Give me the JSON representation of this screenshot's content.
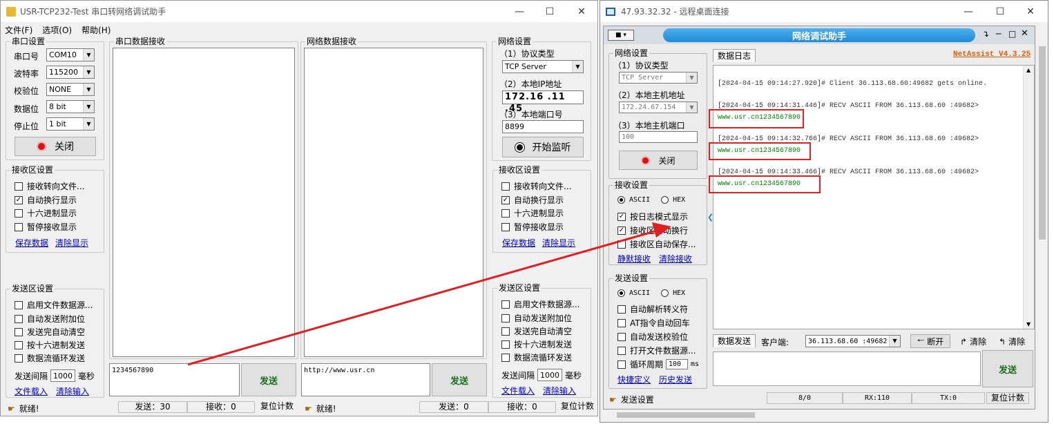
{
  "left": {
    "title": "USR-TCP232-Test 串口转网络调试助手",
    "menu": [
      "文件(F)",
      "选项(O)",
      "帮助(H)"
    ],
    "serial_settings": {
      "title": "串口设置",
      "port_label": "串口号",
      "port": "COM10",
      "baud_label": "波特率",
      "baud": "115200",
      "parity_label": "校验位",
      "parity": "NONE",
      "databits_label": "数据位",
      "databits": "8 bit",
      "stopbits_label": "停止位",
      "stopbits": "1 bit",
      "close_btn": "关闭"
    },
    "serial_receive_title": "串口数据接收",
    "net_receive_title": "网络数据接收",
    "recv_settings_left": {
      "title": "接收区设置",
      "options": [
        {
          "label": "接收转向文件...",
          "checked": false
        },
        {
          "label": "自动换行显示",
          "checked": true
        },
        {
          "label": "十六进制显示",
          "checked": false
        },
        {
          "label": "暂停接收显示",
          "checked": false
        }
      ],
      "save": "保存数据",
      "clear": "清除显示"
    },
    "send_settings_left": {
      "title": "发送区设置",
      "options": [
        {
          "label": "启用文件数据源...",
          "checked": false
        },
        {
          "label": "自动发送附加位",
          "checked": false
        },
        {
          "label": "发送完自动清空",
          "checked": false
        },
        {
          "label": "按十六进制发送",
          "checked": false
        },
        {
          "label": "数据流循环发送",
          "checked": false
        }
      ],
      "interval_label": "发送间隔",
      "interval": "1000",
      "unit": "毫秒",
      "load": "文件载入",
      "clear": "清除输入"
    },
    "serial_send_text": "1234567890",
    "net_send_text": "http://www.usr.cn",
    "send_btn": "发送",
    "net_settings": {
      "title": "网络设置",
      "proto_label": "（1）协议类型",
      "proto": "TCP Server",
      "ip_label": "（2）本地IP地址",
      "ip": "172.16 .11 .45",
      "port_label": "（3）本地端口号",
      "port": "8899",
      "listen_btn": "开始监听"
    },
    "recv_settings_right": {
      "title": "接收区设置",
      "options": [
        {
          "label": "接收转向文件...",
          "checked": false
        },
        {
          "label": "自动换行显示",
          "checked": true
        },
        {
          "label": "十六进制显示",
          "checked": false
        },
        {
          "label": "暂停接收显示",
          "checked": false
        }
      ],
      "save": "保存数据",
      "clear": "清除显示"
    },
    "send_settings_right": {
      "title": "发送区设置",
      "options": [
        {
          "label": "启用文件数据源...",
          "checked": false
        },
        {
          "label": "自动发送附加位",
          "checked": false
        },
        {
          "label": "发送完自动清空",
          "checked": false
        },
        {
          "label": "按十六进制发送",
          "checked": false
        },
        {
          "label": "数据流循环发送",
          "checked": false
        }
      ],
      "interval_label": "发送间隔",
      "interval": "1000",
      "unit": "毫秒",
      "load": "文件载入",
      "clear": "清除输入"
    },
    "status": {
      "ready1": "就绪!",
      "send1": "发送：30",
      "recv1": "接收：0",
      "reset1": "复位计数",
      "ready2": "就绪!",
      "send2": "发送：0",
      "recv2": "接收：0",
      "reset2": "复位计数"
    }
  },
  "right": {
    "title": "47.93.32.32 - 远程桌面连接",
    "app_title": "网络调试助手",
    "version": "NetAssist V4.3.25",
    "net_settings": {
      "title": "网络设置",
      "proto_label": "（1）协议类型",
      "proto": "TCP Server",
      "host_label": "（2）本地主机地址",
      "host": "172.24.67.154",
      "port_label": "（3）本地主机端口",
      "port": "100",
      "close_btn": "关闭"
    },
    "recv_settings": {
      "title": "接收设置",
      "ascii": "ASCII",
      "hex": "HEX",
      "options": [
        {
          "label": "按日志模式显示",
          "checked": true
        },
        {
          "label": "接收区自动换行",
          "checked": true
        },
        {
          "label": "接收区自动保存...",
          "checked": false
        }
      ],
      "save": "静默接收",
      "clear": "清除接收"
    },
    "send_settings": {
      "title": "发送设置",
      "ascii": "ASCII",
      "hex": "HEX",
      "options": [
        {
          "label": "自动解析转义符",
          "checked": false
        },
        {
          "label": "AT指令自动回车",
          "checked": false
        },
        {
          "label": "自动发送校验位",
          "checked": false
        },
        {
          "label": "打开文件数据源...",
          "checked": false
        }
      ],
      "loop_label": "循环周期",
      "loop_value": "100",
      "loop_unit": "ms",
      "shortcut": "快捷定义",
      "history": "历史发送"
    },
    "log_tab": "数据日志",
    "log_lines": [
      {
        "text": "[2024-04-15 09:14:27.920]# Client 36.113.68.60:49682 gets online.",
        "green": false
      },
      {
        "text": "[2024-04-15 09:14:31.446]# RECV ASCII FROM 36.113.68.60 :49682>",
        "green": false
      },
      {
        "text": "www.usr.cn1234567890",
        "green": true
      },
      {
        "text": "[2024-04-15 09:14:32.766]# RECV ASCII FROM 36.113.68.60 :49682>",
        "green": false
      },
      {
        "text": "www.usr.cn1234567890",
        "green": true
      },
      {
        "text": "[2024-04-15 09:14:33.466]# RECV ASCII FROM 36.113.68.60 :49682>",
        "green": false
      },
      {
        "text": "www.usr.cn1234567890",
        "green": true
      }
    ],
    "send_tab": "数据发送",
    "client_label": "客户端:",
    "client": "36.113.68.60 :49682",
    "disconnect": "断开",
    "clear1": "清除",
    "clear2": "清除",
    "send_btn": "发送",
    "status": {
      "label": "发送设置",
      "count": "8/0",
      "rx": "RX:110",
      "tx": "TX:0",
      "reset": "复位计数"
    }
  },
  "colors": {
    "annotation": "#e02020",
    "netassist_blue": "#1e8ad8",
    "log_green": "#008000",
    "version": "#e65c00"
  }
}
